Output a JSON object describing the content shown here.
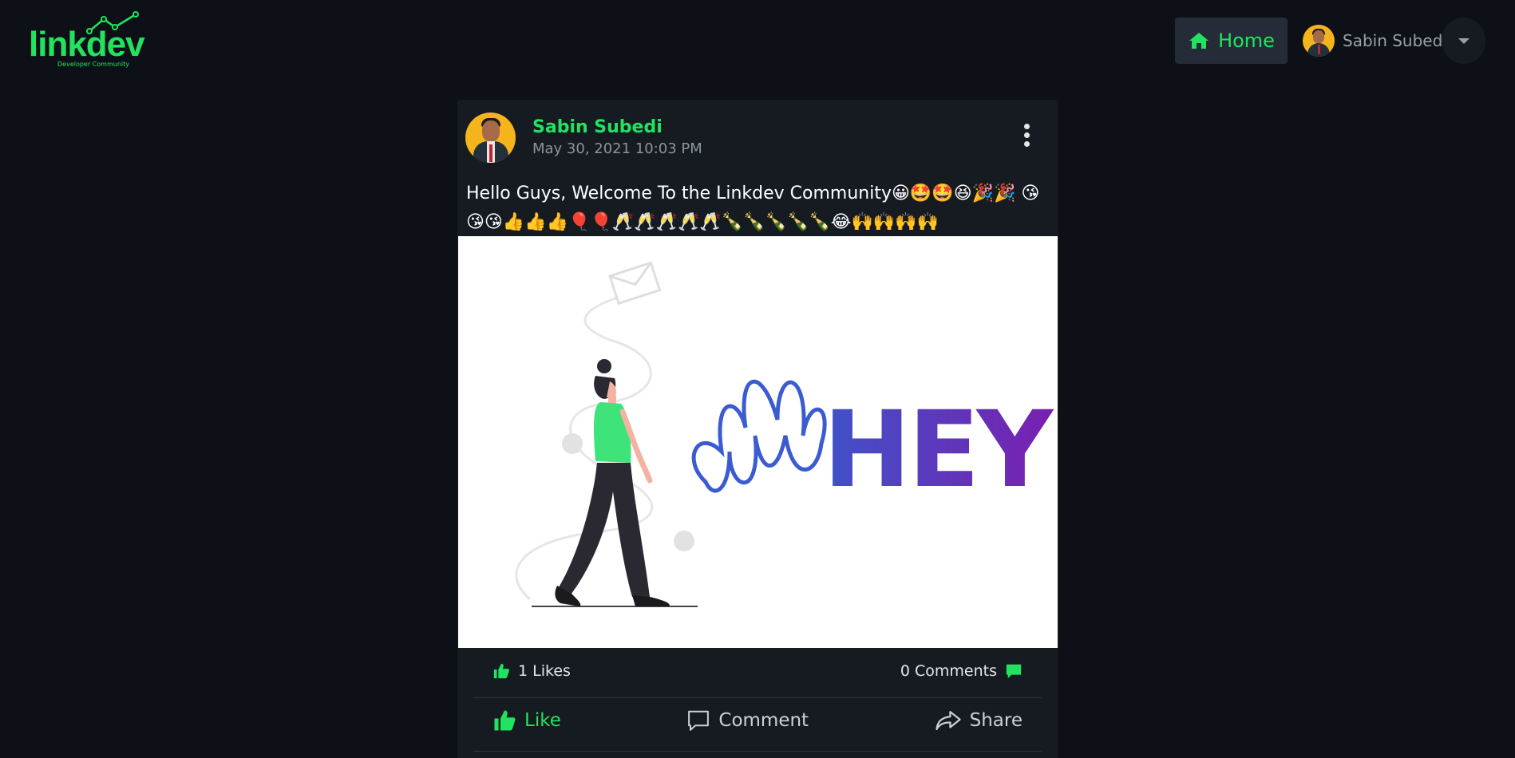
{
  "brand": {
    "name": "linkdev",
    "tagline": "Developer Community",
    "color": "#22e35f"
  },
  "nav": {
    "home_label": "Home",
    "user_name": "Sabin Subedi"
  },
  "post": {
    "author": "Sabin Subedi",
    "date": "May 30, 2021 10:03 PM",
    "text": "Hello Guys, Welcome To the Linkdev Community😀🤩🤩😆🎉🎉 😘😘😘👍👍👍🎈🎈🥂🥂🥂🥂🥂🍾🍾🍾🍾🍾😂🙌🙌🙌🙌",
    "image_text": "HEY",
    "likes": "1 Likes",
    "comments": "0 Comments"
  },
  "actions": {
    "like": "Like",
    "comment": "Comment",
    "share": "Share"
  },
  "colors": {
    "background": "#0d1117",
    "card": "#161b22",
    "accent": "#22e35f"
  }
}
